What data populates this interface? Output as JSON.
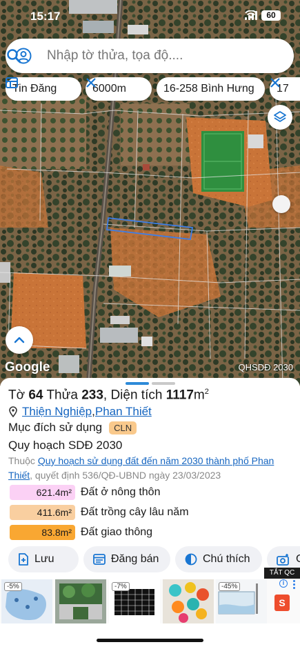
{
  "status_bar": {
    "time": "15:17",
    "battery": "60"
  },
  "search": {
    "placeholder": "Nhập tờ thửa, tọa độ...."
  },
  "filter_chips": [
    {
      "label": "Tin Đăng",
      "icon": "table-icon"
    },
    {
      "label": "6000m",
      "icon": "ruler-icon"
    },
    {
      "label": "16-258 Bình Hưng",
      "icon": "none"
    },
    {
      "label": "17",
      "icon": "ruler-icon"
    }
  ],
  "map": {
    "google_label": "Google",
    "layer_badge": "QHSDĐ 2030",
    "colors": {
      "parcel_outline": "#3d7ee8",
      "soil": "#c86a32",
      "field": "#2f8f3f"
    }
  },
  "parcel": {
    "to_label": "Tờ",
    "to_value": "64",
    "thua_label": "Thửa",
    "thua_value": "233",
    "area_label": "Diện tích",
    "area_value": "1117",
    "area_unit": "m",
    "area_unit_sup": "2",
    "ward": "Thiện Nghiệp",
    "separator": ", ",
    "city": "Phan Thiết",
    "purpose_label": "Mục đích sử dụng",
    "purpose_code": "CLN"
  },
  "planning": {
    "title": "Quy hoạch SDĐ 2030",
    "desc_prefix": "Thuộc ",
    "desc_link": "Quy hoạch sử dụng đất đến năm 2030 thành phố Phan Thiết",
    "desc_suffix": ", quyết định 536/QĐ-UBND ngày 23/03/2023",
    "legend": [
      {
        "area": "621.4m²",
        "name": "Đất ở nông thôn",
        "color": "#fbd1f5"
      },
      {
        "area": "411.6m²",
        "name": "Đất trồng cây lâu năm",
        "color": "#f9cfa0"
      },
      {
        "area": "83.8m²",
        "name": "Đất giao thông",
        "color": "#f9a732"
      }
    ]
  },
  "actions": [
    {
      "label": "Lưu",
      "icon": "save-icon"
    },
    {
      "label": "Đăng bán",
      "icon": "listing-icon"
    },
    {
      "label": "Chú thích",
      "icon": "contrast-icon"
    },
    {
      "label": "C",
      "icon": "camera-icon"
    }
  ],
  "ads": {
    "close_label": "TẮT QC",
    "badges": [
      "-5%",
      "-7%",
      "-45%"
    ]
  }
}
